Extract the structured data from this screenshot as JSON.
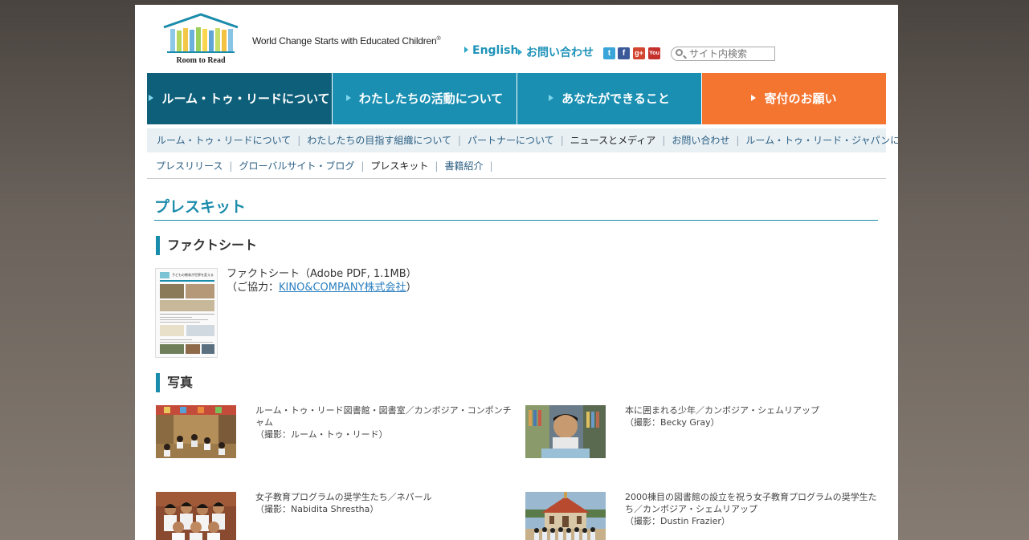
{
  "header": {
    "logo_text": "Room to Read",
    "tagline": "World Change Starts with Educated Children",
    "tagline_mark": "®",
    "links": [
      {
        "label": "English"
      },
      {
        "label": "お問い合わせ"
      }
    ],
    "social": [
      {
        "icon": "twitter-icon",
        "glyph": "t",
        "color": "#3aa5d8"
      },
      {
        "icon": "facebook-icon",
        "glyph": "f",
        "color": "#3b5998"
      },
      {
        "icon": "google-plus-icon",
        "glyph": "g+",
        "color": "#d3462f"
      },
      {
        "icon": "youtube-icon",
        "glyph": "You",
        "color": "#c4302b"
      }
    ],
    "search_placeholder": "サイト内検索"
  },
  "mainnav": [
    {
      "label": "ルーム・トゥ・リードについて",
      "color": "#0e5f7a"
    },
    {
      "label": "わたしたちの活動について",
      "color": "#1a8fb2"
    },
    {
      "label": "あなたができること",
      "color": "#1a8fb2"
    },
    {
      "label": "寄付のお願い",
      "color": "#f47530"
    }
  ],
  "subnav": {
    "row1": [
      "ルーム・トゥ・リードについて",
      "わたしたちの目指す組織について",
      "パートナーについて",
      "ニュースとメディア",
      "お問い合わせ",
      "ルーム・トゥ・リード・ジャパンについて"
    ],
    "row2": [
      "プレスリリース",
      "グローバルサイト・ブログ",
      "プレスキット",
      "書籍紹介"
    ]
  },
  "content": {
    "title": "プレスキット",
    "factsheet_heading": "ファクトシート",
    "factsheet_thumb_title": "子どもの教育が世界を変える",
    "factsheet_line1": "ファクトシート（Adobe PDF, 1.1MB）",
    "factsheet_line2_prefix": "（ご協力：",
    "factsheet_link": "KINO&COMPANY株式会社",
    "factsheet_line2_suffix": "）",
    "photos_heading": "写真",
    "photos": [
      {
        "caption": "ルーム・トゥ・リード図書館・図書室／カンボジア・コンポンチャム",
        "credit": "（撮影：ルーム・トゥ・リード）"
      },
      {
        "caption": "本に囲まれる少年／カンボジア・シェムリアップ",
        "credit": "（撮影：Becky Gray）"
      },
      {
        "caption": "女子教育プログラムの奨学生たち／ネパール",
        "credit": "（撮影：Nabidita Shrestha）"
      },
      {
        "caption": "2000棟目の図書館の設立を祝う女子教育プログラムの奨学生たち／カンボジア・シェムリアップ",
        "credit": "（撮影：Dustin Frazier）"
      }
    ]
  }
}
